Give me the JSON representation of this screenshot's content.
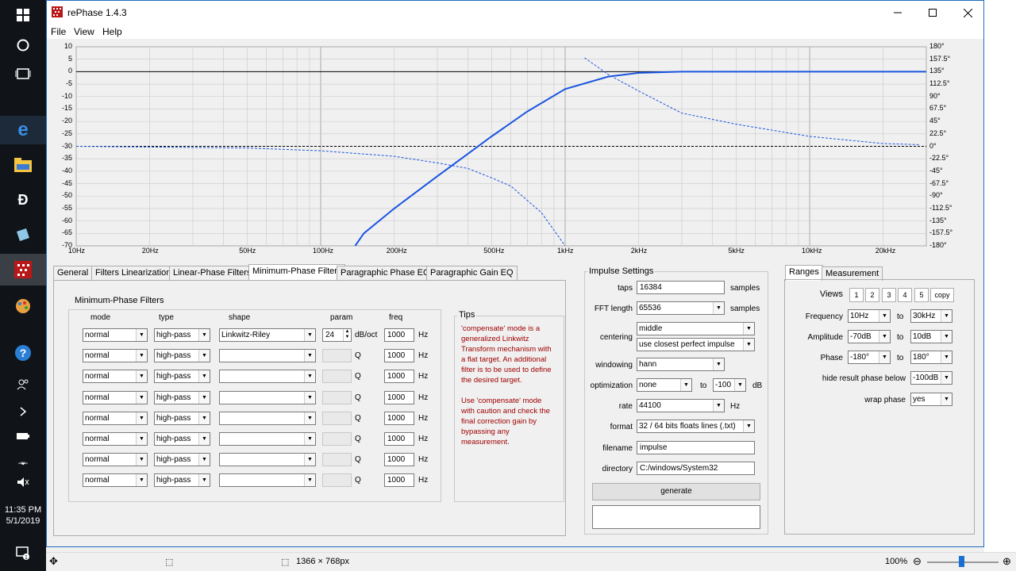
{
  "window": {
    "title": "rePhase 1.4.3"
  },
  "menu": [
    "File",
    "View",
    "Help"
  ],
  "plot": {
    "y_left_ticks": [
      "10",
      "5",
      "0",
      "-5",
      "-10",
      "-15",
      "-20",
      "-25",
      "-30",
      "-35",
      "-40",
      "-45",
      "-50",
      "-55",
      "-60",
      "-65",
      "-70"
    ],
    "y_right_ticks": [
      "180°",
      "157.5°",
      "135°",
      "112.5°",
      "90°",
      "67.5°",
      "45°",
      "22.5°",
      "0°",
      "-22.5°",
      "-45°",
      "-67.5°",
      "-90°",
      "-112.5°",
      "-135°",
      "-157.5°",
      "-180°"
    ],
    "x_ticks": [
      "10Hz",
      "20Hz",
      "50Hz",
      "100Hz",
      "200Hz",
      "500Hz",
      "1kHz",
      "2kHz",
      "5kHz",
      "10kHz",
      "20kHz"
    ],
    "colors": {
      "bg": "#f0f0f0",
      "grid": "#c8c8c8",
      "curve": "#1a55e0",
      "axis": "#000000"
    }
  },
  "chart_data": {
    "type": "line",
    "x_scale": "log",
    "xlim_hz": [
      10,
      30000
    ],
    "ylim_db": [
      -70,
      10
    ],
    "y2lim_deg": [
      -180,
      180
    ],
    "series": [
      {
        "style": "solid",
        "axis": "amplitude_db",
        "x_hz": [
          100,
          150,
          200,
          300,
          400,
          500,
          700,
          1000,
          1500,
          2000,
          3000,
          30000
        ],
        "y": [
          -90,
          -65,
          -55,
          -42,
          -33,
          -26,
          -16,
          -7,
          -2,
          -0.5,
          0,
          0
        ]
      },
      {
        "style": "dashed",
        "axis": "phase_deg",
        "x_hz": [
          10,
          50,
          100,
          200,
          300,
          400,
          500,
          600,
          800,
          1000,
          1200,
          1500,
          2000,
          3000,
          5000,
          10000,
          20000,
          28000
        ],
        "y": [
          0,
          -3,
          -8,
          -18,
          -30,
          -40,
          -57,
          -72,
          -120,
          -180,
          160,
          130,
          100,
          60,
          40,
          18,
          5,
          3
        ]
      }
    ]
  },
  "tabs": [
    "General",
    "Filters Linearization",
    "Linear-Phase Filters",
    "Minimum-Phase Filters",
    "Paragraphic Phase EQ",
    "Paragraphic Gain EQ"
  ],
  "mpf": {
    "title": "Minimum-Phase Filters",
    "headers": {
      "mode": "mode",
      "type": "type",
      "shape": "shape",
      "param": "param",
      "freq": "freq"
    },
    "rows": [
      {
        "mode": "normal",
        "type": "high-pass",
        "shape": "Linkwitz-Riley",
        "param": "24",
        "unit": "dB/oct",
        "freq": "1000",
        "hz": "Hz"
      },
      {
        "mode": "normal",
        "type": "high-pass",
        "shape": "",
        "param": "",
        "unit": "Q",
        "freq": "1000",
        "hz": "Hz"
      },
      {
        "mode": "normal",
        "type": "high-pass",
        "shape": "",
        "param": "",
        "unit": "Q",
        "freq": "1000",
        "hz": "Hz"
      },
      {
        "mode": "normal",
        "type": "high-pass",
        "shape": "",
        "param": "",
        "unit": "Q",
        "freq": "1000",
        "hz": "Hz"
      },
      {
        "mode": "normal",
        "type": "high-pass",
        "shape": "",
        "param": "",
        "unit": "Q",
        "freq": "1000",
        "hz": "Hz"
      },
      {
        "mode": "normal",
        "type": "high-pass",
        "shape": "",
        "param": "",
        "unit": "Q",
        "freq": "1000",
        "hz": "Hz"
      },
      {
        "mode": "normal",
        "type": "high-pass",
        "shape": "",
        "param": "",
        "unit": "Q",
        "freq": "1000",
        "hz": "Hz"
      },
      {
        "mode": "normal",
        "type": "high-pass",
        "shape": "",
        "param": "",
        "unit": "Q",
        "freq": "1000",
        "hz": "Hz"
      }
    ]
  },
  "tips": {
    "title": "Tips",
    "p1": "'compensate' mode is a generalized Linkwitz Transform mechanism with a flat target. An additional filter is to be used to define the desired target.",
    "p2": "Use 'compensate' mode with caution and check the final correction gain by bypassing any measurement.",
    "color": "#a00000"
  },
  "impulse": {
    "title": "Impulse Settings",
    "taps_label": "taps",
    "taps": "16384",
    "taps_unit": "samples",
    "fft_label": "FFT length",
    "fft": "65536",
    "fft_unit": "samples",
    "centering_label": "centering",
    "centering1": "middle",
    "centering2": "use closest perfect impulse",
    "windowing_label": "windowing",
    "windowing": "hann",
    "opt_label": "optimization",
    "opt": "none",
    "opt_to": "to",
    "opt_db": "-100",
    "opt_unit": "dB",
    "rate_label": "rate",
    "rate": "44100",
    "rate_unit": "Hz",
    "format_label": "format",
    "format": "32 / 64 bits floats lines (.txt)",
    "filename_label": "filename",
    "filename": "impulse",
    "directory_label": "directory",
    "directory": "C:/windows/System32",
    "generate": "generate",
    "output": ""
  },
  "ranges": {
    "tabs": [
      "Ranges",
      "Measurement"
    ],
    "views_label": "Views",
    "views": [
      "1",
      "2",
      "3",
      "4",
      "5"
    ],
    "copy": "copy",
    "freq_label": "Frequency",
    "freq_from": "10Hz",
    "freq_to": "30kHz",
    "amp_label": "Amplitude",
    "amp_from": "-70dB",
    "amp_to": "10dB",
    "phase_label": "Phase",
    "phase_from": "-180°",
    "phase_to": "180°",
    "to": "to",
    "hide_label": "hide result phase below",
    "hide": "-100dB",
    "wrap_label": "wrap phase",
    "wrap": "yes"
  },
  "taskbar": {
    "time": "11:35 PM",
    "date": "5/1/2019"
  },
  "status": {
    "dimensions": "1366 × 768px",
    "zoom": "100%"
  }
}
